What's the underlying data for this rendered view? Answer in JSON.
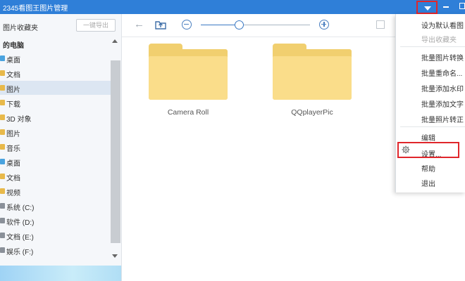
{
  "app": {
    "title": "2345看图王图片管理"
  },
  "sidebar": {
    "favorites_title": "图片收藏夹",
    "export_button": "一键导出",
    "tree": [
      {
        "label": "的电脑",
        "icon": "computer-icon",
        "selected": false
      },
      {
        "label": "桌面",
        "icon": "desktop-folder-icon",
        "selected": false
      },
      {
        "label": "文档",
        "icon": "folder-icon",
        "selected": false
      },
      {
        "label": "图片",
        "icon": "folder-icon",
        "selected": true
      },
      {
        "label": "下载",
        "icon": "folder-icon",
        "selected": false
      },
      {
        "label": "3D 对象",
        "icon": "folder-icon",
        "selected": false
      },
      {
        "label": "图片",
        "icon": "folder-icon",
        "selected": false
      },
      {
        "label": "音乐",
        "icon": "folder-icon",
        "selected": false
      },
      {
        "label": "桌面",
        "icon": "desktop-folder-icon",
        "selected": false
      },
      {
        "label": "文档",
        "icon": "folder-icon",
        "selected": false
      },
      {
        "label": "视频",
        "icon": "folder-icon",
        "selected": false
      },
      {
        "label": "系统 (C:)",
        "icon": "drive-icon",
        "selected": false
      },
      {
        "label": "软件 (D:)",
        "icon": "drive-icon",
        "selected": false
      },
      {
        "label": "文档 (E:)",
        "icon": "drive-icon",
        "selected": false
      },
      {
        "label": "娱乐 (F:)",
        "icon": "drive-icon",
        "selected": false
      }
    ]
  },
  "folders": [
    {
      "name": "Camera Roll"
    },
    {
      "name": "QQplayerPic"
    }
  ],
  "menu": {
    "items": [
      {
        "label": "设为默认看图",
        "disabled": false
      },
      {
        "label": "导出收藏夹",
        "disabled": true
      },
      {
        "label": "批量图片转换",
        "disabled": false
      },
      {
        "label": "批量重命名...",
        "disabled": false
      },
      {
        "label": "批量添加水印",
        "disabled": false
      },
      {
        "label": "批量添加文字",
        "disabled": false
      },
      {
        "label": "批量照片转正",
        "disabled": false
      },
      {
        "label": "编辑",
        "disabled": false
      },
      {
        "label": "设置...",
        "disabled": false,
        "highlighted": true
      },
      {
        "label": "帮助",
        "disabled": false
      },
      {
        "label": "退出",
        "disabled": false
      }
    ]
  },
  "colors": {
    "title_bar": "#2f7fd8",
    "highlight_border": "#e0262b",
    "folder": "#f1cf6f",
    "sidebar_selected": "#dce6f2"
  }
}
